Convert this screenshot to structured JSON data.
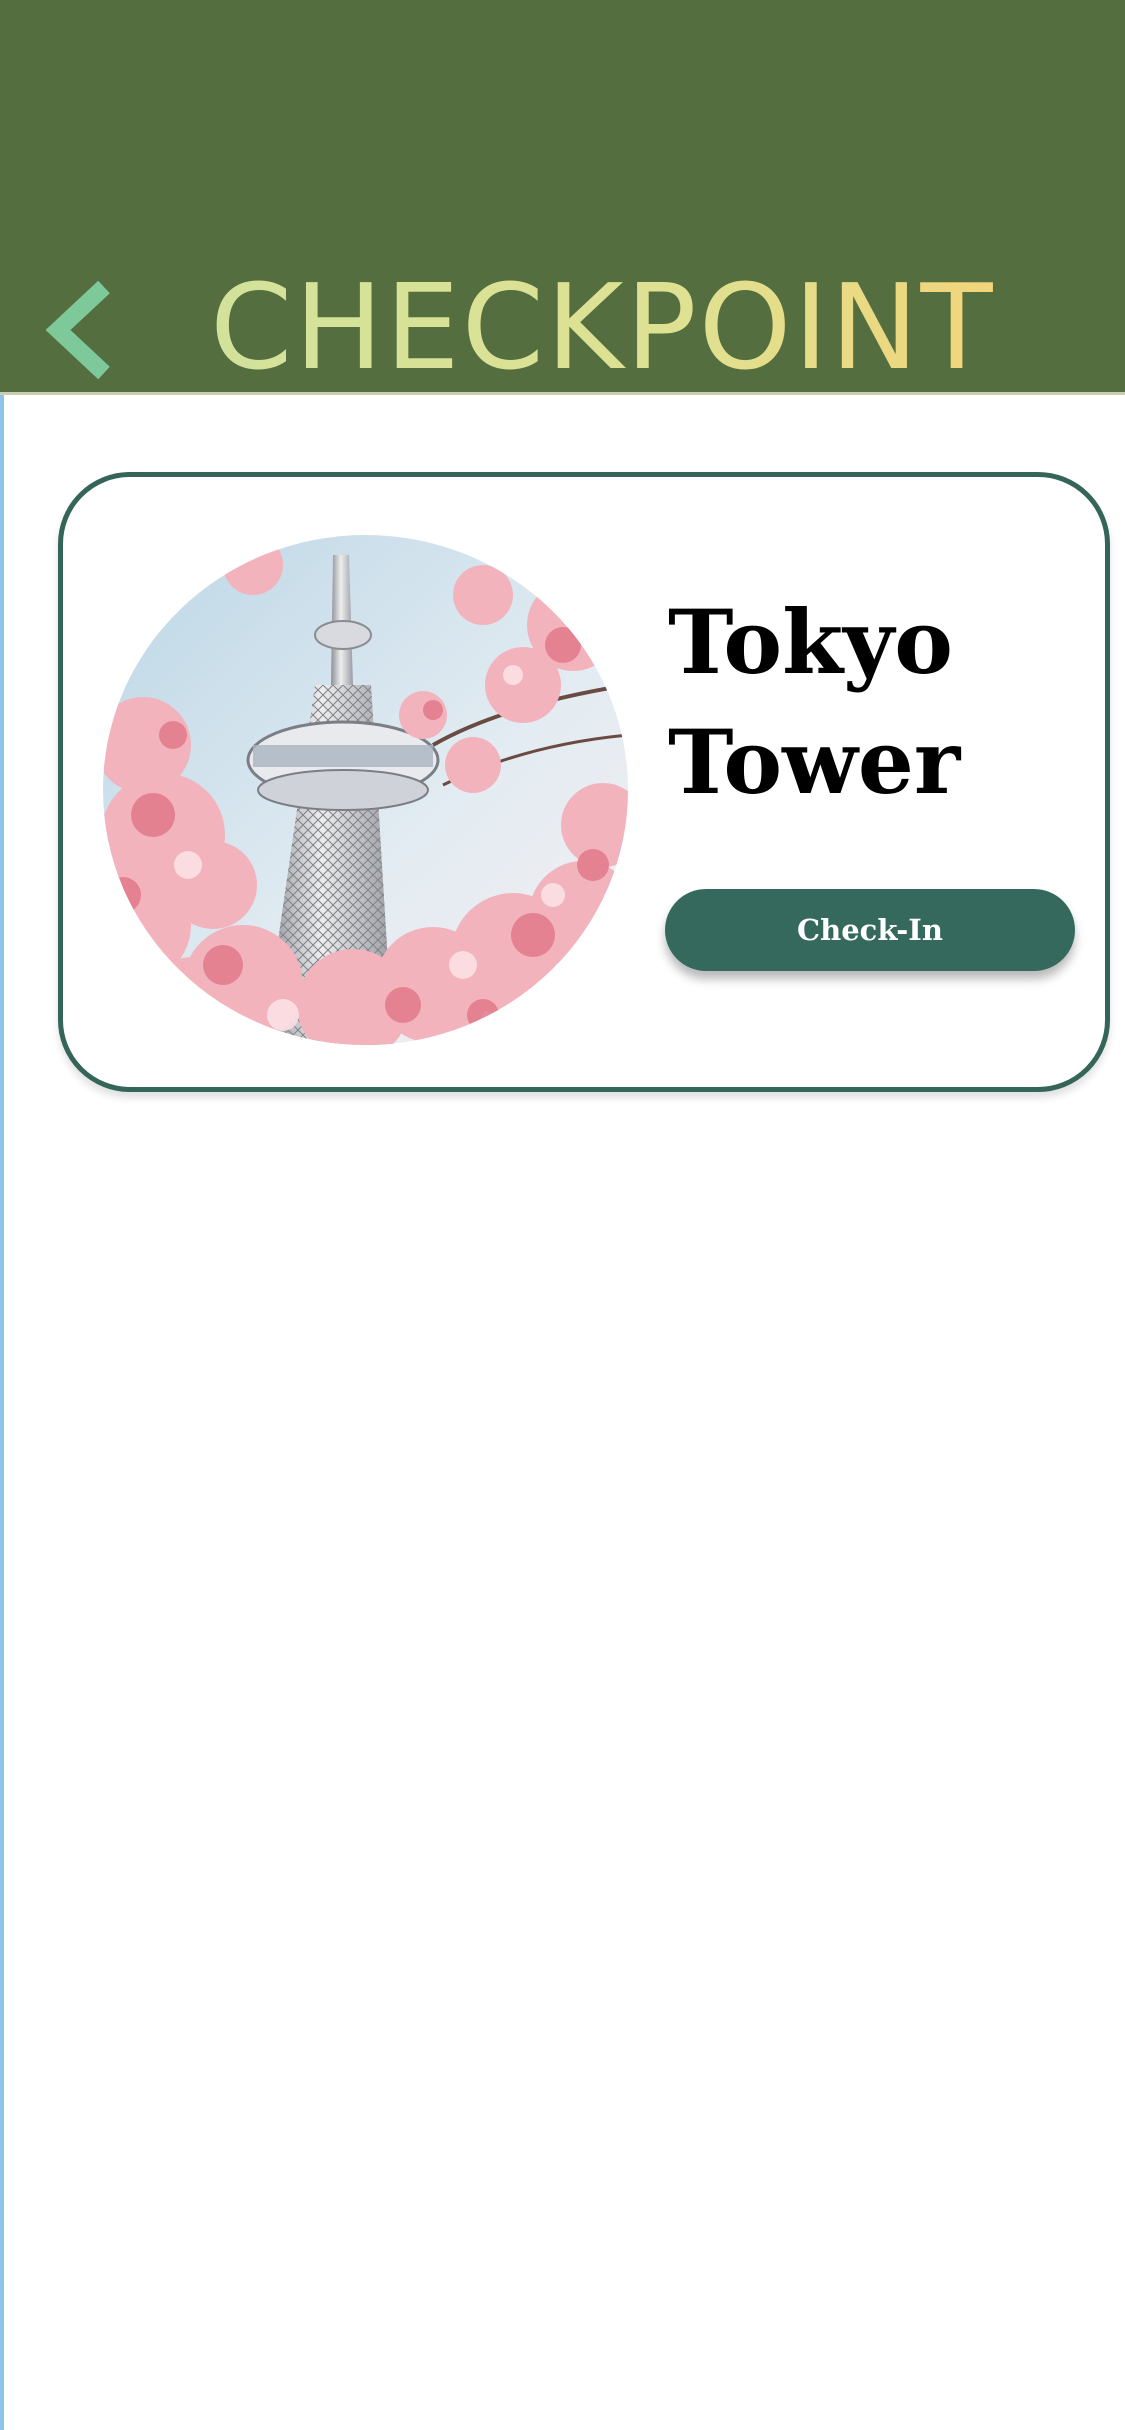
{
  "header": {
    "back_icon": "chevron-left-icon",
    "title": "CHECKPOINT",
    "background_color": "#546e3f",
    "title_gradient": [
      "#d2e29b",
      "#f2d479"
    ],
    "back_icon_color": "#7ec99a"
  },
  "checkpoints": [
    {
      "name": "Tokyo Tower",
      "photo": "tower-with-cherry-blossoms-photo",
      "button_label": "Check-In"
    }
  ],
  "colors": {
    "card_border": "#356559",
    "button_background": "#35695d",
    "button_text": "#ffffff"
  }
}
